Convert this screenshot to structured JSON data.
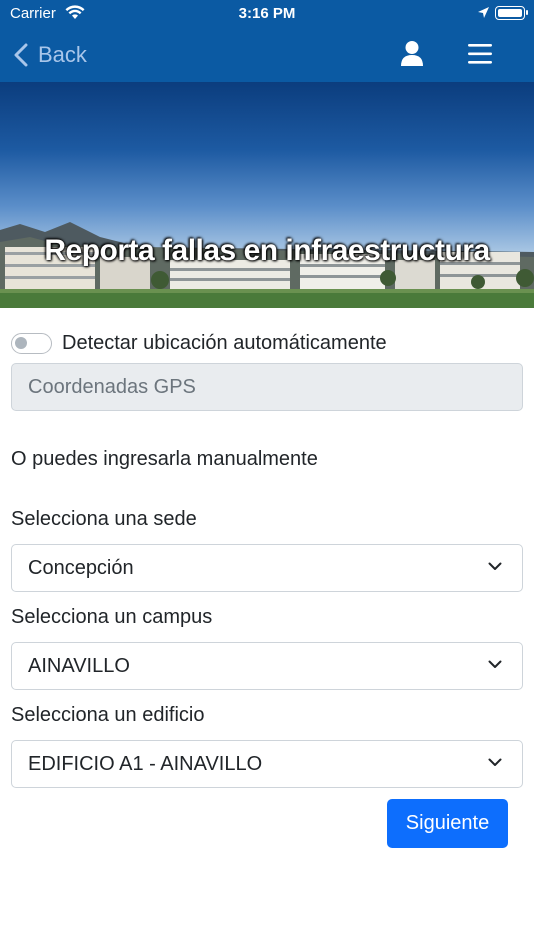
{
  "status": {
    "carrier": "Carrier",
    "time": "3:16 PM"
  },
  "nav": {
    "back_label": "Back"
  },
  "hero": {
    "title": "Reporta fallas en infraestructura"
  },
  "location": {
    "auto_detect_label": "Detectar ubicación automáticamente",
    "auto_detect_on": false,
    "gps_placeholder": "Coordenadas GPS",
    "gps_value": ""
  },
  "manual_text": "O puedes ingresarla manualmente",
  "fields": {
    "sede": {
      "label": "Selecciona una sede",
      "value": "Concepción"
    },
    "campus": {
      "label": "Selecciona un campus",
      "value": "AINAVILLO"
    },
    "edificio": {
      "label": "Selecciona un edificio",
      "value": "EDIFICIO A1 - AINAVILLO"
    }
  },
  "next_button": "Siguiente",
  "colors": {
    "nav_bar": "#0b5aa3",
    "primary_button": "#0d6efd",
    "back_text": "#a9c6ea"
  },
  "icons": [
    "wifi-icon",
    "location-arrow-icon",
    "battery-icon",
    "chevron-left-icon",
    "user-icon",
    "hamburger-menu-icon",
    "chevron-down-icon"
  ]
}
